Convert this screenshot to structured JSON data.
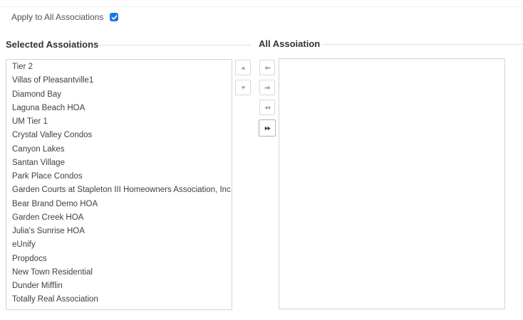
{
  "apply": {
    "label": "Apply to All Associations",
    "checked": true
  },
  "selected": {
    "title": "Selected Assoiations",
    "items": [
      "Tier 2",
      "Villas of Pleasantville1",
      "Diamond Bay",
      "Laguna Beach HOA",
      "UM Tier 1",
      "Crystal Valley Condos",
      "Canyon Lakes",
      "Santan Village",
      "Park Place Condos",
      "Garden Courts at Stapleton III Homeowners Association, Inc.",
      "Bear Brand Demo HOA",
      "Garden Creek HOA",
      "Julia's Sunrise HOA",
      "eUnify",
      "Propdocs",
      "New Town Residential",
      "Dunder Mifflin",
      "Totally Real Association"
    ]
  },
  "all": {
    "title": "All Assoiation",
    "items": []
  },
  "controls": {
    "move_up": "up-arrow-icon",
    "move_down": "down-arrow-icon",
    "move_left": "left-arrow-icon",
    "move_right": "right-arrow-icon",
    "move_all_left": "double-left-arrow-icon",
    "move_all_right": "double-right-arrow-icon"
  },
  "colors": {
    "accent": "#1a73e8",
    "rule": "#d5e2ee",
    "border": "#cfd5da"
  }
}
